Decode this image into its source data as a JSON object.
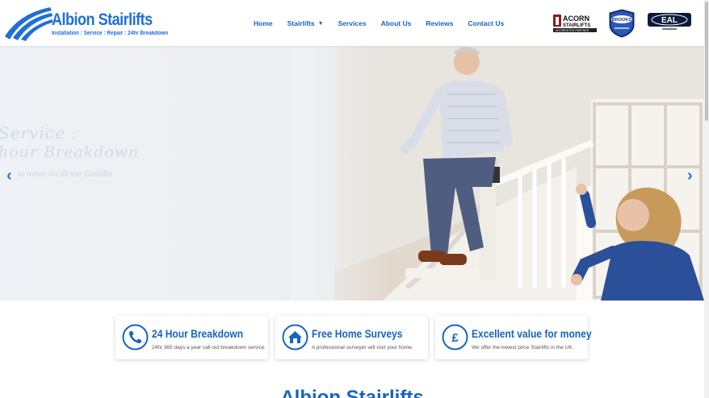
{
  "brand": {
    "name": "Albion Stairlifts",
    "tagline": "Installation : Service : Repair : 24hr Breakdown",
    "color": "#1f6fd6"
  },
  "nav": {
    "items": [
      {
        "label": "Home"
      },
      {
        "label": "Stairlifts"
      },
      {
        "label": "Services"
      },
      {
        "label": "About Us"
      },
      {
        "label": "Reviews"
      },
      {
        "label": "Contact Us"
      }
    ]
  },
  "badges": {
    "acorn_line1": "ACORN",
    "acorn_line2": "STAIRLIFTS",
    "acorn_line3": "ACCREDITED PARTNER",
    "brooks": "BROOKS",
    "eal": "EAL"
  },
  "hero": {
    "title_line1": "Service :",
    "title_line2": "hour Breakdown",
    "subtitle": "to move on all the Stairlifts"
  },
  "features": [
    {
      "icon": "phone-icon",
      "title": "24 Hour Breakdown",
      "text": "24hr 365 days a year call out breakdown service."
    },
    {
      "icon": "home-icon",
      "title": "Free Home Surveys",
      "text": "A professional surveyer will visit your home."
    },
    {
      "icon": "pound-icon",
      "title": "Excellent value for money",
      "text": "We offer the lowest price Stairlifts in the UK."
    }
  ],
  "section": {
    "title": "Albion Stairlifts"
  },
  "colors": {
    "accent": "#1565c0",
    "arrow": "#1e78e0"
  }
}
